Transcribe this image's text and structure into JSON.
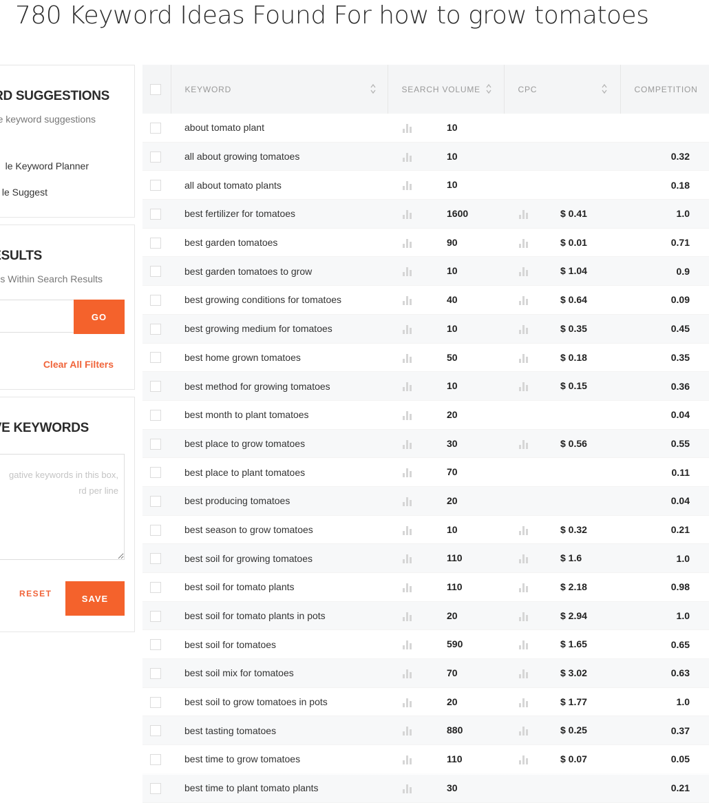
{
  "page_title": "780 Keyword Ideas Found For how to grow tomatoes",
  "sidebar": {
    "suggestions_panel": {
      "heading": "RD SUGGESTIONS",
      "subtitle": "e keyword suggestions",
      "options": [
        "le Keyword Planner",
        "le Suggest"
      ]
    },
    "results_panel": {
      "heading": "ESULTS",
      "subtitle": "rds Within Search Results",
      "search_value": "",
      "go_label": "GO",
      "clear_label": "Clear All Filters"
    },
    "negative_panel": {
      "heading": "VE KEYWORDS",
      "placeholder": "gative keywords in this box,\nrd per line",
      "reset_label": "RESET",
      "save_label": "SAVE"
    }
  },
  "table": {
    "headers": {
      "keyword": "KEYWORD",
      "search_volume": "SEARCH VOLUME",
      "cpc": "CPC",
      "competition": "COMPETITION"
    },
    "rows": [
      {
        "keyword": "about tomato plant",
        "volume": "10",
        "cpc": "",
        "competition": ""
      },
      {
        "keyword": "all about growing tomatoes",
        "volume": "10",
        "cpc": "",
        "competition": "0.32"
      },
      {
        "keyword": "all about tomato plants",
        "volume": "10",
        "cpc": "",
        "competition": "0.18"
      },
      {
        "keyword": "best fertilizer for tomatoes",
        "volume": "1600",
        "cpc": "$ 0.41",
        "competition": "1.0"
      },
      {
        "keyword": "best garden tomatoes",
        "volume": "90",
        "cpc": "$ 0.01",
        "competition": "0.71"
      },
      {
        "keyword": "best garden tomatoes to grow",
        "volume": "10",
        "cpc": "$ 1.04",
        "competition": "0.9"
      },
      {
        "keyword": "best growing conditions for tomatoes",
        "volume": "40",
        "cpc": "$ 0.64",
        "competition": "0.09"
      },
      {
        "keyword": "best growing medium for tomatoes",
        "volume": "10",
        "cpc": "$ 0.35",
        "competition": "0.45"
      },
      {
        "keyword": "best home grown tomatoes",
        "volume": "50",
        "cpc": "$ 0.18",
        "competition": "0.35"
      },
      {
        "keyword": "best method for growing tomatoes",
        "volume": "10",
        "cpc": "$ 0.15",
        "competition": "0.36"
      },
      {
        "keyword": "best month to plant tomatoes",
        "volume": "20",
        "cpc": "",
        "competition": "0.04"
      },
      {
        "keyword": "best place to grow tomatoes",
        "volume": "30",
        "cpc": "$ 0.56",
        "competition": "0.55"
      },
      {
        "keyword": "best place to plant tomatoes",
        "volume": "70",
        "cpc": "",
        "competition": "0.11"
      },
      {
        "keyword": "best producing tomatoes",
        "volume": "20",
        "cpc": "",
        "competition": "0.04"
      },
      {
        "keyword": "best season to grow tomatoes",
        "volume": "10",
        "cpc": "$ 0.32",
        "competition": "0.21"
      },
      {
        "keyword": "best soil for growing tomatoes",
        "volume": "110",
        "cpc": "$ 1.6",
        "competition": "1.0"
      },
      {
        "keyword": "best soil for tomato plants",
        "volume": "110",
        "cpc": "$ 2.18",
        "competition": "0.98"
      },
      {
        "keyword": "best soil for tomato plants in pots",
        "volume": "20",
        "cpc": "$ 2.94",
        "competition": "1.0"
      },
      {
        "keyword": "best soil for tomatoes",
        "volume": "590",
        "cpc": "$ 1.65",
        "competition": "0.65"
      },
      {
        "keyword": "best soil mix for tomatoes",
        "volume": "70",
        "cpc": "$ 3.02",
        "competition": "0.63"
      },
      {
        "keyword": "best soil to grow tomatoes in pots",
        "volume": "20",
        "cpc": "$ 1.77",
        "competition": "1.0"
      },
      {
        "keyword": "best tasting tomatoes",
        "volume": "880",
        "cpc": "$ 0.25",
        "competition": "0.37"
      },
      {
        "keyword": "best time to grow tomatoes",
        "volume": "110",
        "cpc": "$ 0.07",
        "competition": "0.05"
      },
      {
        "keyword": "best time to plant tomato plants",
        "volume": "30",
        "cpc": "",
        "competition": "0.21"
      }
    ]
  },
  "icons": {
    "sort": "sort-arrows-icon",
    "trend": "bar-chart-icon",
    "checkbox": "checkbox-icon"
  },
  "colors": {
    "accent": "#f4622c",
    "header_bg": "#f4f5f6",
    "row_alt_bg": "#f7f8f9",
    "icon_gray": "#d0d0d0"
  }
}
